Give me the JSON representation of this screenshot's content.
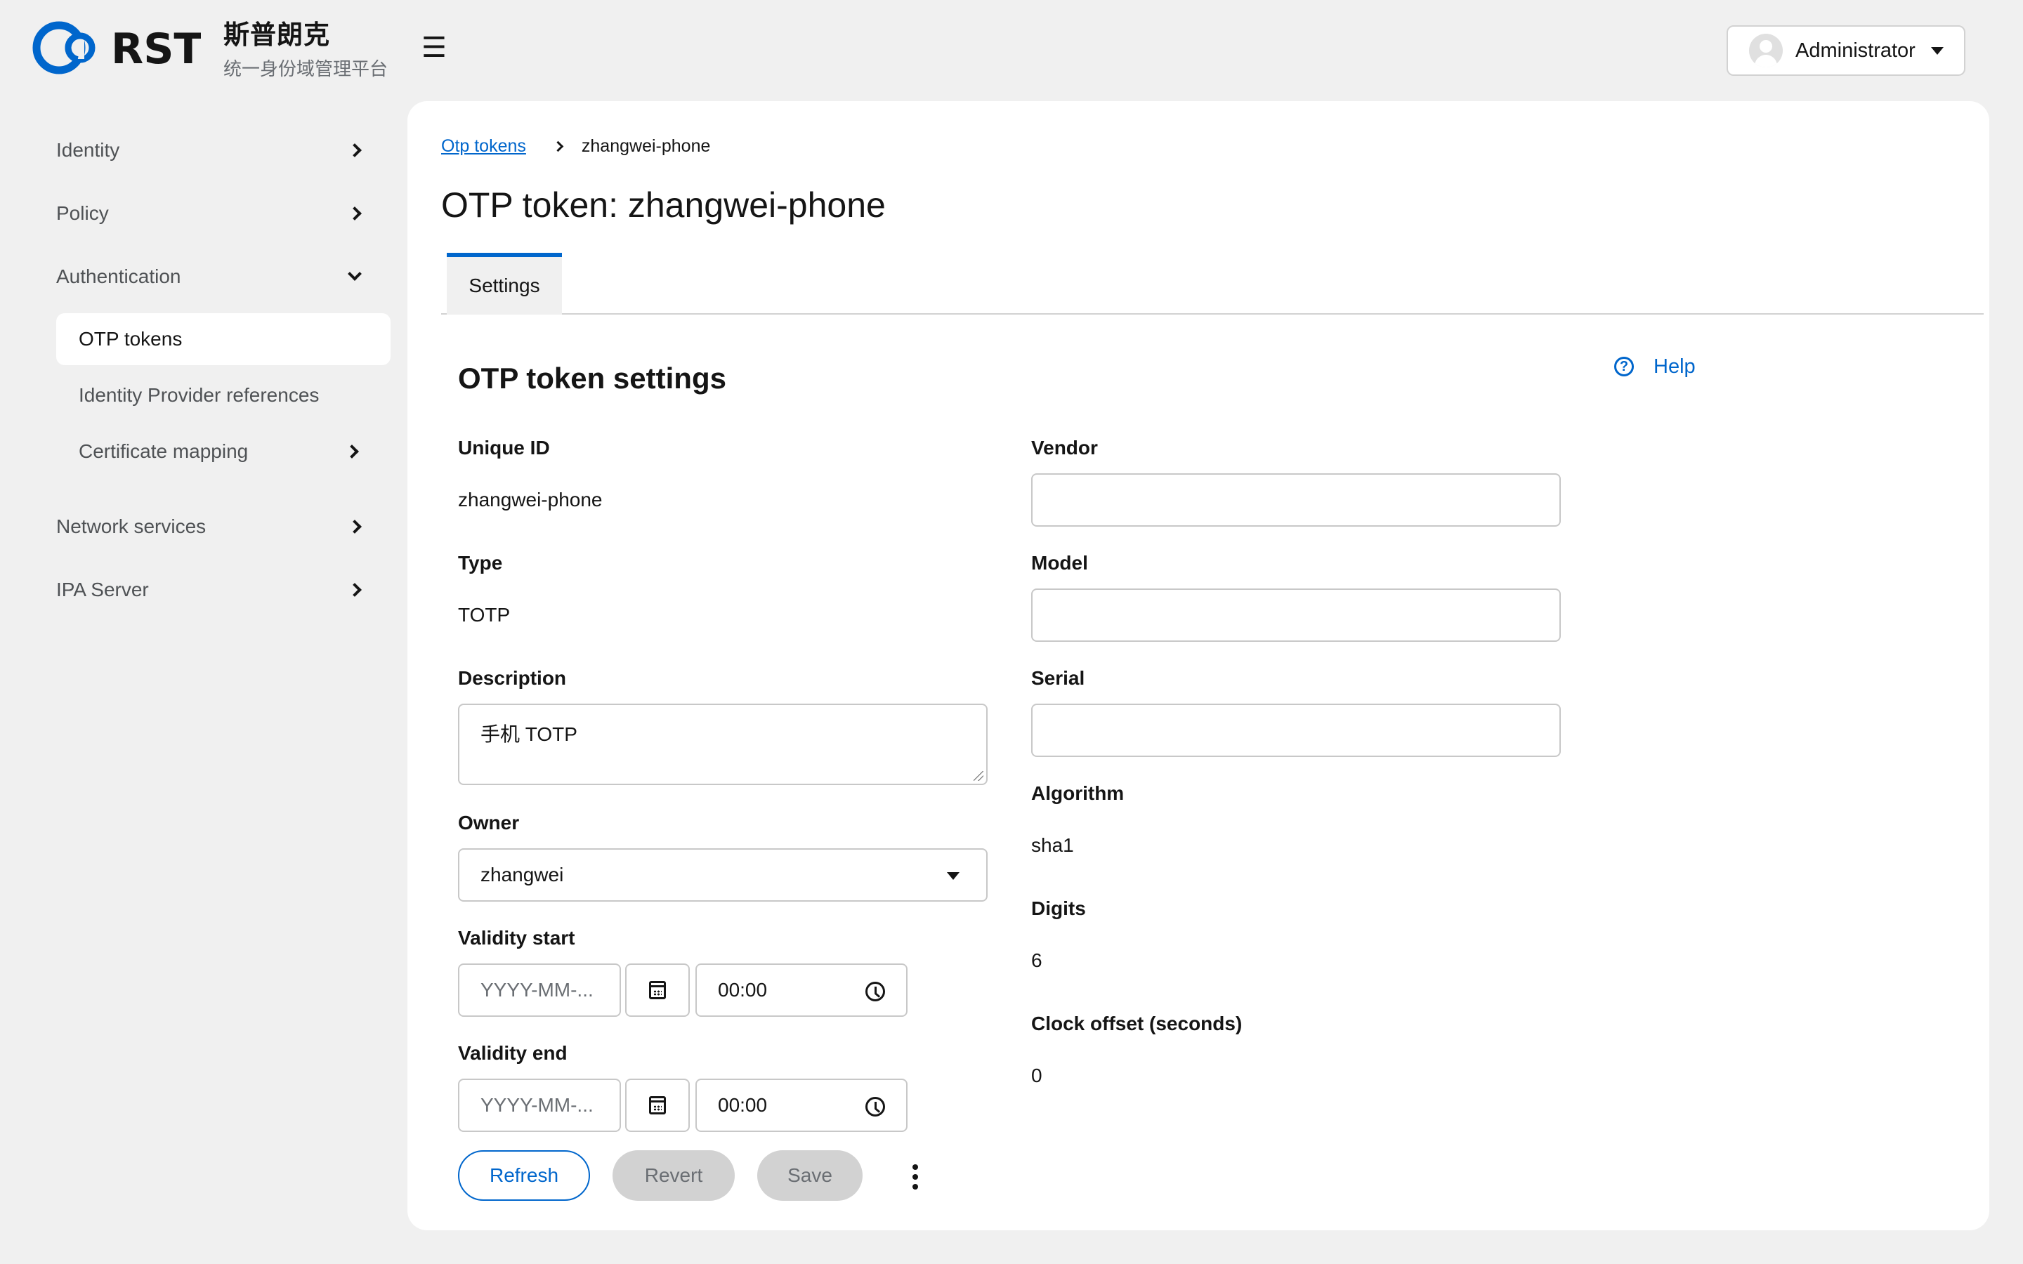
{
  "brand": {
    "logo_text": "RST",
    "title": "斯普朗克",
    "subtitle": "统一身份域管理平台",
    "accent_color": "#0066cc"
  },
  "header": {
    "menu_icon": "hamburger-icon",
    "user": "Administrator"
  },
  "sidebar": {
    "items": [
      {
        "label": "Identity",
        "icon": "chevron-right-icon"
      },
      {
        "label": "Policy",
        "icon": "chevron-right-icon"
      },
      {
        "label": "Authentication",
        "icon": "chevron-down-icon",
        "expanded": true
      },
      {
        "label": "Network services",
        "icon": "chevron-right-icon"
      },
      {
        "label": "IPA Server",
        "icon": "chevron-right-icon"
      }
    ],
    "sub_items": [
      {
        "label": "OTP tokens",
        "active": true
      },
      {
        "label": "Identity Provider references"
      },
      {
        "label": "Certificate mapping",
        "icon": "chevron-right-icon"
      }
    ]
  },
  "breadcrumb": {
    "parent": "Otp tokens",
    "current": "zhangwei-phone"
  },
  "page": {
    "title": "OTP token: zhangwei-phone",
    "tabs": [
      "Settings"
    ],
    "section_title": "OTP token settings",
    "help": "Help"
  },
  "fields": {
    "unique_id": {
      "label": "Unique ID",
      "value": "zhangwei-phone"
    },
    "type": {
      "label": "Type",
      "value": "TOTP"
    },
    "description": {
      "label": "Description",
      "value": "手机 TOTP"
    },
    "owner": {
      "label": "Owner",
      "value": "zhangwei"
    },
    "validity_start": {
      "label": "Validity start",
      "date_placeholder": "YYYY-MM-...",
      "time": "00:00"
    },
    "validity_end": {
      "label": "Validity end",
      "date_placeholder": "YYYY-MM-...",
      "time": "00:00"
    },
    "vendor": {
      "label": "Vendor",
      "value": ""
    },
    "model": {
      "label": "Model",
      "value": ""
    },
    "serial": {
      "label": "Serial",
      "value": ""
    },
    "algorithm": {
      "label": "Algorithm",
      "value": "sha1"
    },
    "digits": {
      "label": "Digits",
      "value": "6"
    },
    "clock_offset": {
      "label": "Clock offset (seconds)",
      "value": "0"
    }
  },
  "actions": {
    "refresh": "Refresh",
    "revert": "Revert",
    "save": "Save"
  }
}
